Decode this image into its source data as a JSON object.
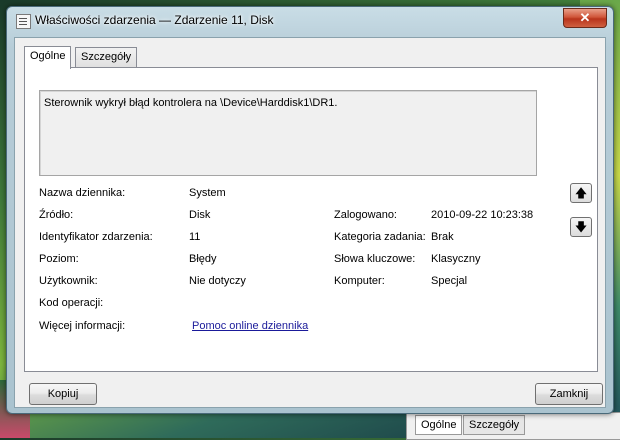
{
  "window": {
    "title": "Właściwości zdarzenia — Zdarzenie 11, Disk",
    "close_symbol": "✕"
  },
  "tabs": [
    {
      "label": "Ogólne",
      "active": true
    },
    {
      "label": "Szczegóły",
      "active": false
    }
  ],
  "message": "Sterownik wykrył błąd kontrolera na \\Device\\Harddisk1\\DR1.",
  "fields": {
    "log_name": {
      "label": "Nazwa dziennika:",
      "value": "System"
    },
    "source": {
      "label": "Źródło:",
      "value": "Disk"
    },
    "event_id": {
      "label": "Identyfikator zdarzenia:",
      "value": "11"
    },
    "level": {
      "label": "Poziom:",
      "value": "Błędy"
    },
    "user": {
      "label": "Użytkownik:",
      "value": "Nie dotyczy"
    },
    "opcode": {
      "label": "Kod operacji:",
      "value": ""
    },
    "more_info": {
      "label": "Więcej informacji:",
      "link": "Pomoc online dziennika"
    },
    "logged": {
      "label": "Zalogowano:",
      "value": "2010-09-22 10:23:38"
    },
    "task_category": {
      "label": "Kategoria zadania:",
      "value": "Brak"
    },
    "keywords": {
      "label": "Słowa kluczowe:",
      "value": "Klasyczny"
    },
    "computer": {
      "label": "Komputer:",
      "value": "Specjal"
    }
  },
  "nav": {
    "up_icon": "arrow-up-icon",
    "down_icon": "arrow-down-icon"
  },
  "buttons": {
    "copy": "Kopiuj",
    "close": "Zamknij"
  },
  "background_window": {
    "tabs": [
      "Ogólne",
      "Szczegóły"
    ]
  }
}
